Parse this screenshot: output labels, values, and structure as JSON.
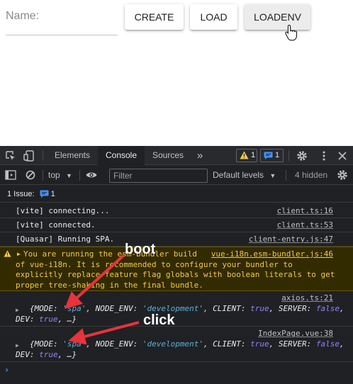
{
  "app": {
    "name_label": "Name:",
    "create_label": "CREATE",
    "load_label": "LOAD",
    "loadenv_label": "LOADENV"
  },
  "devtools": {
    "tabs": [
      "Elements",
      "Console",
      "Sources",
      "»"
    ],
    "warnings_count": "1",
    "messages_count": "1",
    "context": "top",
    "filter_placeholder": "Filter",
    "levels": "Default levels",
    "hidden": "4 hidden",
    "issue_label": "1 Issue:",
    "issue_count": "1"
  },
  "console": {
    "messages": [
      {
        "text": "[vite] connecting...",
        "source": "client.ts:16"
      },
      {
        "text": "[vite] connected.",
        "source": "client.ts:53"
      },
      {
        "text": "[Quasar] Running SPA.",
        "source": "client-entry.js:47"
      }
    ],
    "warning": {
      "lines": [
        "You are running the esm-bundler build",
        "of vue-i18n. It is recommended to configure your bundler to",
        "explicitly replace feature flag globals with boolean literals to get",
        "proper tree-shaking in the final bundle."
      ],
      "source": "vue-i18n.esm-bundler.js:46"
    },
    "logs": [
      {
        "source": "axios.ts:21"
      },
      {
        "source": "IndexPage.vue:38"
      }
    ],
    "object": {
      "MODE": "'spa'",
      "NODE_ENV": "'development'",
      "CLIENT": "true",
      "SERVER": "false",
      "DEV": "true"
    }
  },
  "annotations": {
    "boot": "boot",
    "click": "click",
    "arrow_color": "#e8323c"
  },
  "colors": {
    "devtools_bg": "#202124",
    "warning_bg": "#332b00",
    "warning_text": "#f2c94c",
    "string_value": "#5db0d7",
    "keyword_value": "#9980ff",
    "accent_blue": "#3e93ff"
  }
}
